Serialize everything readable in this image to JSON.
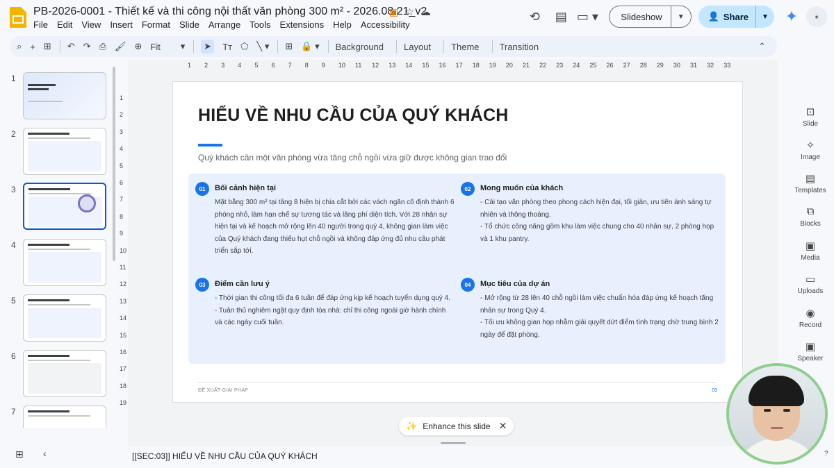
{
  "app": {
    "doc_title": "PB-2026-0001 - Thiết kế và thi công nội thất văn phòng 300 m² - 2026.08.21_v2",
    "title_icons": [
      "slides-badge-icon",
      "star-icon",
      "cloud-status-icon"
    ]
  },
  "menu": [
    "File",
    "Edit",
    "View",
    "Insert",
    "Format",
    "Slide",
    "Arrange",
    "Tools",
    "Extensions",
    "Help",
    "Accessibility"
  ],
  "header_buttons": {
    "slideshow": "Slideshow",
    "share": "Share"
  },
  "toolbar": {
    "zoom": "Fit",
    "background": "Background",
    "layout": "Layout",
    "theme": "Theme",
    "transition": "Transition"
  },
  "filmstrip": {
    "numbers": [
      "1",
      "2",
      "3",
      "4",
      "5",
      "6",
      "7"
    ],
    "selected": "3"
  },
  "ruler_h": [
    "1",
    "2",
    "3",
    "4",
    "5",
    "6",
    "7",
    "8",
    "9",
    "10",
    "11",
    "12",
    "13",
    "14",
    "15",
    "16",
    "17",
    "18",
    "19",
    "20",
    "21",
    "22",
    "23",
    "24",
    "25",
    "26",
    "27",
    "28",
    "29",
    "30",
    "31",
    "32",
    "33"
  ],
  "ruler_v": [
    "1",
    "2",
    "3",
    "4",
    "5",
    "6",
    "7",
    "8",
    "9",
    "10",
    "11",
    "12",
    "13",
    "14",
    "15",
    "16",
    "17",
    "18",
    "19"
  ],
  "slide": {
    "title": "HIỂU VỀ NHU CẦU CỦA QUÝ KHÁCH",
    "subtitle": "Quý khách cần một văn phòng vừa tăng chỗ ngồi vừa giữ được không gian trao đổi",
    "sections": [
      {
        "badge": "01",
        "heading": "Bối cảnh hiện tại",
        "body": "Mặt bằng 300 m² tại tầng 8 hiện bị chia cắt bởi các vách ngăn cố định thành 6 phòng nhỏ, làm hạn chế sự tương tác và lãng phí diện tích. Với 28 nhân sự hiện tại và kế hoạch mở rộng lên 40 người trong quý 4, không gian làm việc của Quý khách đang thiếu hụt chỗ ngồi và không đáp ứng đủ nhu cầu phát triển sắp tới."
      },
      {
        "badge": "02",
        "heading": "Mong muốn của khách",
        "body": "- Cải tạo văn phòng theo phong cách hiện đại, tối giản, ưu tiên ánh sáng tự nhiên và thông thoáng.\n- Tổ chức công năng gồm khu làm việc chung cho 40 nhân sự, 2 phòng họp và 1 khu pantry."
      },
      {
        "badge": "03",
        "heading": "Điểm cần lưu ý",
        "body": "- Thời gian thi công tối đa 6 tuần để đáp ứng kịp kế hoạch tuyển dụng quý 4.\n- Tuân thủ nghiêm ngặt quy định tòa nhà: chỉ thi công ngoài giờ hành chính và các ngày cuối tuần."
      },
      {
        "badge": "04",
        "heading": "Mục tiêu của dự án",
        "body": "- Mở rộng từ 28 lên 40 chỗ ngồi làm việc chuẩn hóa đáp ứng kế hoạch tăng nhân sự trong Quý 4.\n- Tối ưu không gian họp nhằm giải quyết dứt điểm tình trạng chờ trung bình 2 ngày để đặt phòng."
      }
    ],
    "footer": "ĐỀ XUẤT GIẢI PHÁP",
    "page": "03"
  },
  "enhance": {
    "label": "Enhance this slide"
  },
  "side_panel": [
    "Slide",
    "Image",
    "Templates",
    "Blocks",
    "Media",
    "Uploads",
    "Record",
    "Speaker"
  ],
  "notes": "[[SEC:03]] HIỂU VỀ NHU CẦU CỦA QUÝ KHÁCH",
  "colors": {
    "accent": "#1a73e8",
    "share_bg": "#c2e7ff",
    "box_bg": "#e8f0fe"
  }
}
